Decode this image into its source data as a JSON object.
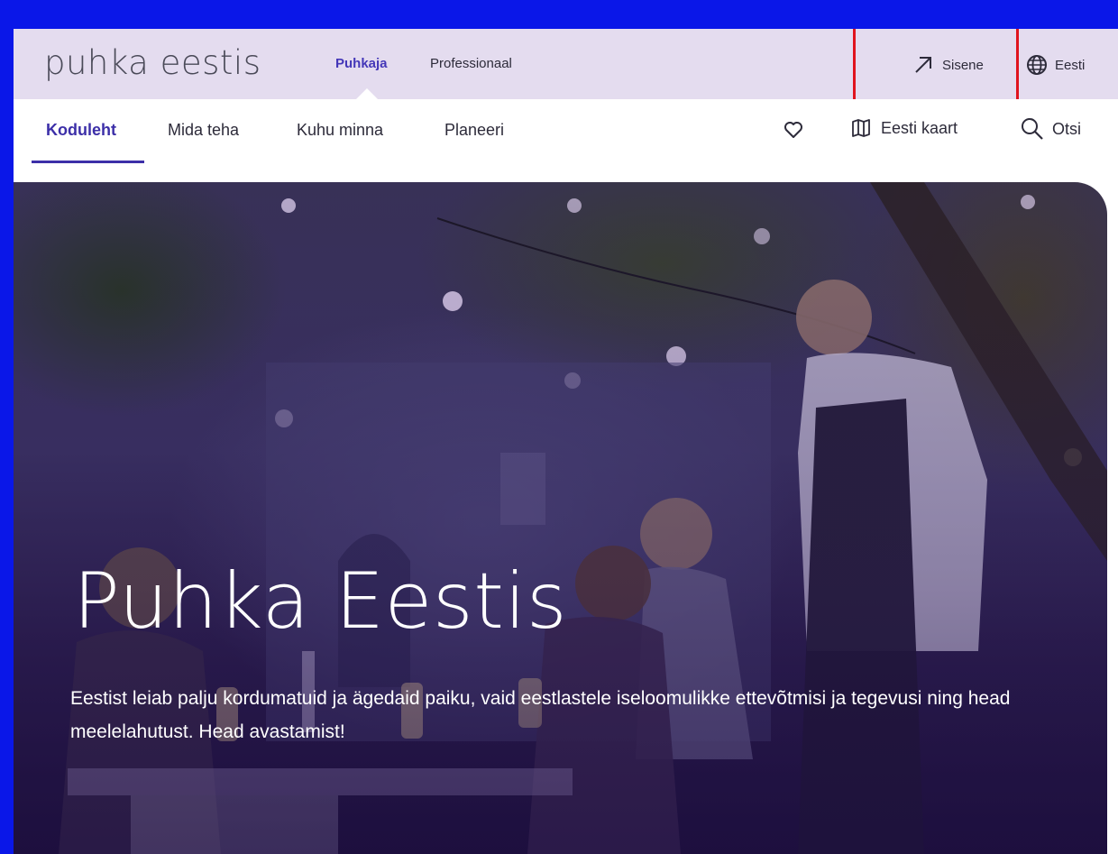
{
  "header": {
    "logo": "puhka eestis",
    "audience_tabs": [
      {
        "label": "Puhkaja",
        "active": true
      },
      {
        "label": "Professionaal",
        "active": false
      }
    ],
    "login_label": "Sisene",
    "language_label": "Eesti"
  },
  "nav": {
    "items": [
      {
        "label": "Koduleht",
        "active": true
      },
      {
        "label": "Mida teha",
        "active": false
      },
      {
        "label": "Kuhu minna",
        "active": false
      },
      {
        "label": "Planeeri",
        "active": false
      }
    ],
    "favorites_icon": "heart-icon",
    "map_label": "Eesti kaart",
    "search_label": "Otsi"
  },
  "hero": {
    "title": "Puhka Eestis",
    "text": "Eestist leiab palju kordumatuid ja ägedaid paiku, vaid eestlastele iseloomulikke ettevõtmisi ja tegevusi ning head meelelahutust. Head avastamist!"
  },
  "colors": {
    "frame": "#0a17e8",
    "topbar": "#e4dcef",
    "accent": "#3c2fa8",
    "highlight": "#e0141e"
  }
}
